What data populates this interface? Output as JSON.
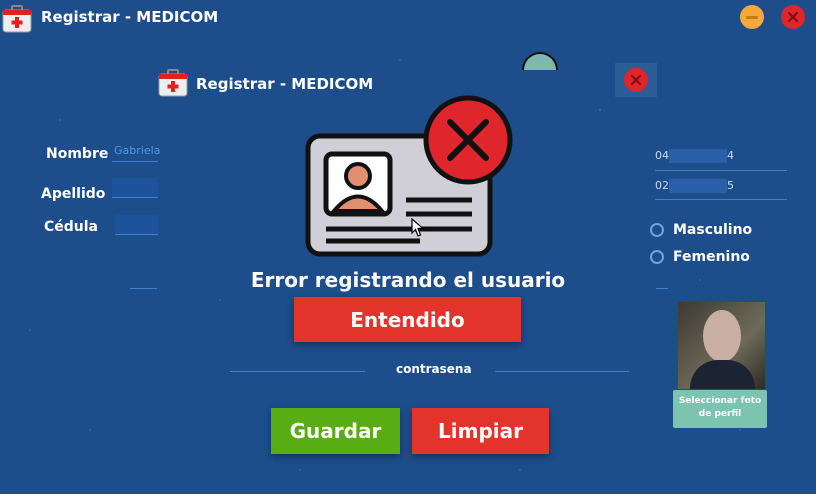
{
  "window": {
    "title": "Registrar - MEDICOM",
    "icon": "medical-kit-icon",
    "minimize_icon": "minimize-icon",
    "close_icon": "close-icon"
  },
  "form": {
    "title": "Registrar - MEDICOM",
    "close_icon": "close-icon",
    "nombre_label": "Nombre",
    "nombre_value": "Gabriela",
    "apellido_label": "Apellido",
    "apellido_value": "",
    "cedula_label": "Cédula",
    "cedula_value": "",
    "right_field_1_prefix": "04",
    "right_field_1_suffix": "4",
    "right_field_2_prefix": "02",
    "right_field_2_suffix": "5",
    "gender_male": "Masculino",
    "gender_female": "Femenino",
    "photo_button": "Seleccionar foto de perfil",
    "password_label": "contrasena",
    "save_button": "Guardar",
    "clear_button": "Limpiar"
  },
  "dialog": {
    "icon": "id-card-error-icon",
    "message": "Error registrando el usuario",
    "ok_button": "Entendido"
  },
  "colors": {
    "background": "#1d4d8a",
    "save_green": "#58ad14",
    "danger_red": "#e3342c",
    "minimize_orange": "#f4a93a",
    "photo_button_teal": "#7cc4b0"
  }
}
